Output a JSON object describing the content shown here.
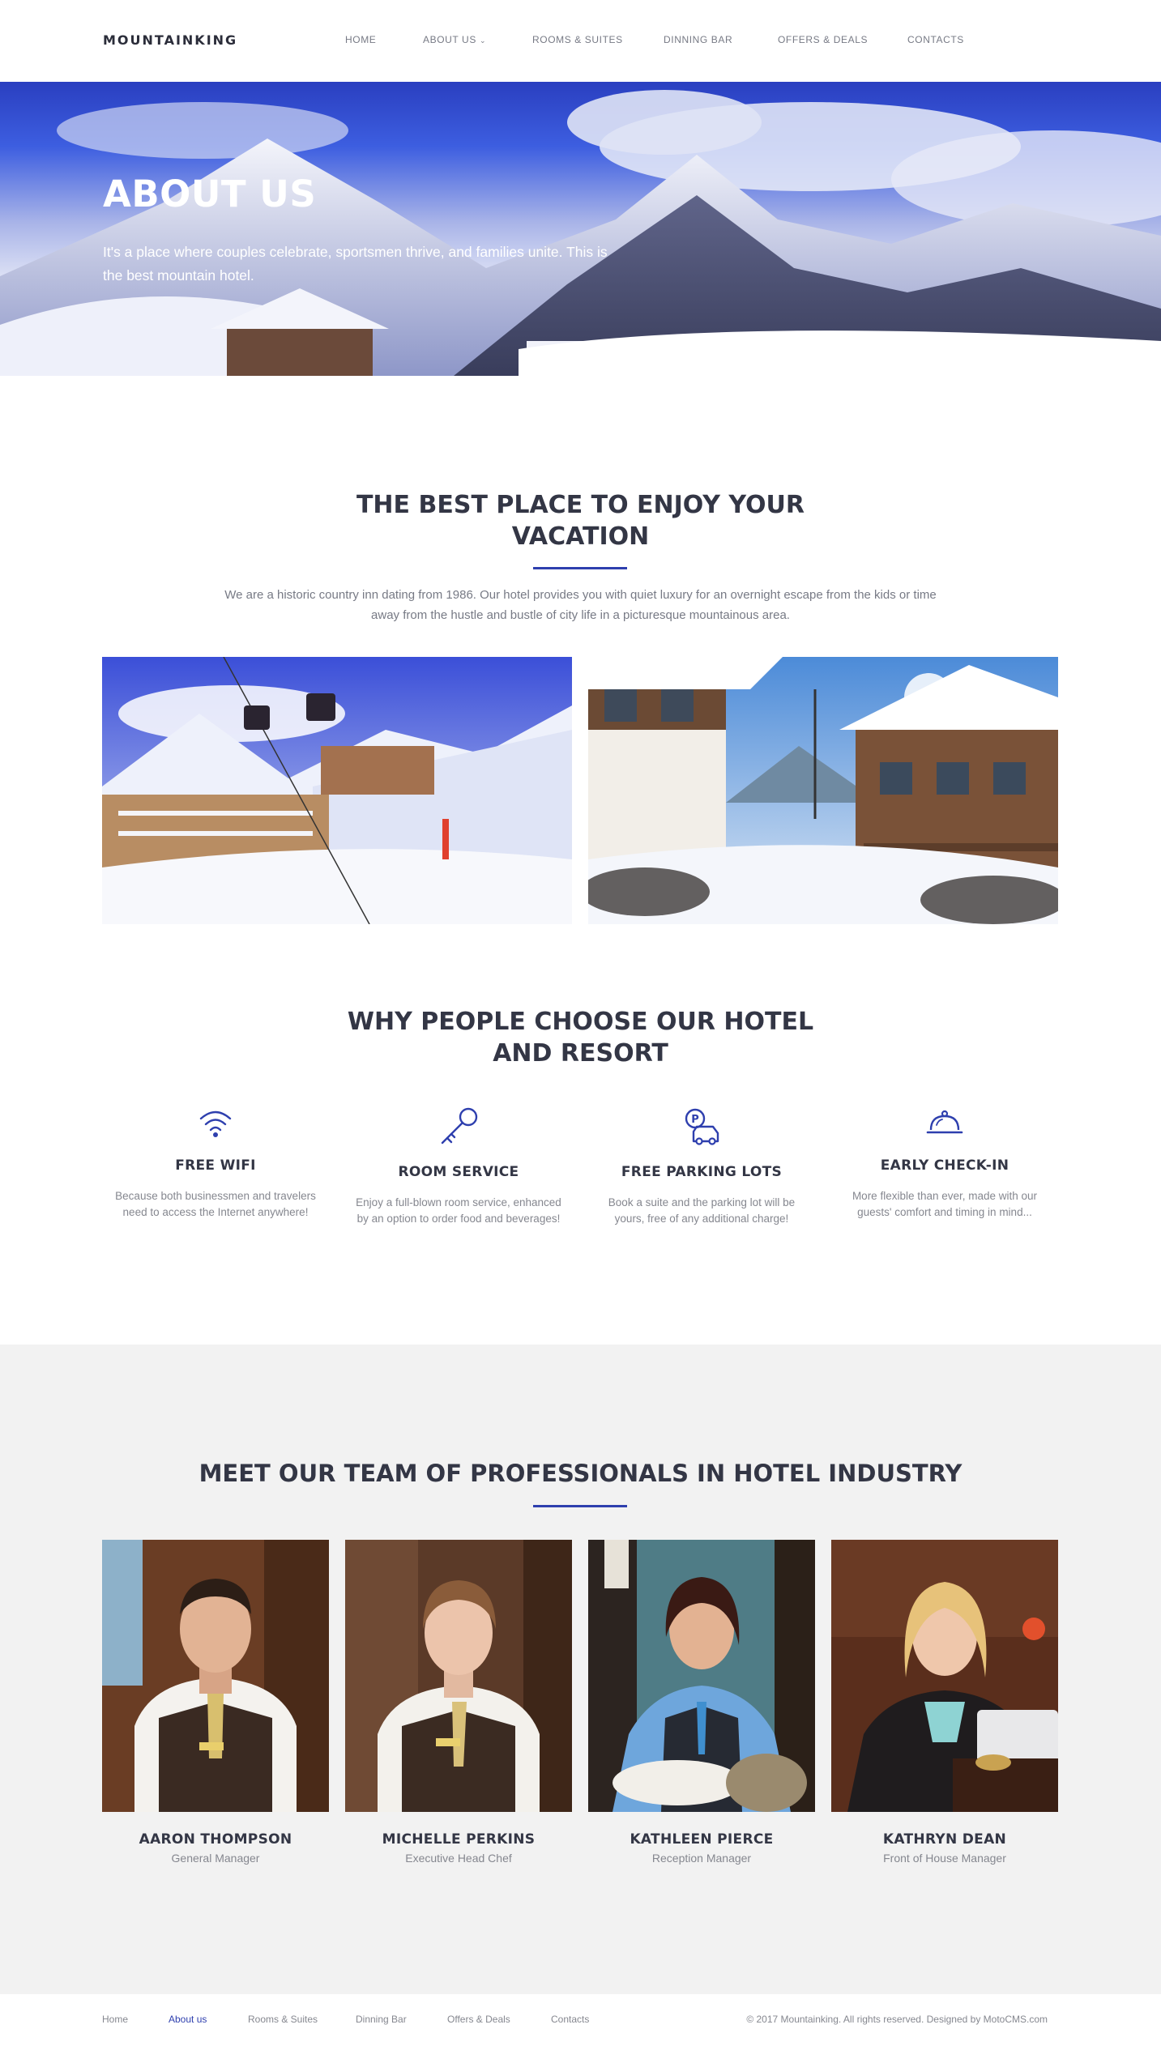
{
  "header": {
    "logo": "MOUNTAINKING",
    "nav": [
      {
        "label": "HOME"
      },
      {
        "label": "ABOUT US"
      },
      {
        "label": "ROOMS & SUITES"
      },
      {
        "label": "DINNING BAR"
      },
      {
        "label": "OFFERS & DEALS"
      },
      {
        "label": "CONTACTS"
      }
    ]
  },
  "hero": {
    "title": "ABOUT US",
    "text": "It's a place where couples celebrate, sportsmen thrive, and families unite. This is the best mountain hotel."
  },
  "intro": {
    "title_line1": "THE BEST PLACE TO ENJOY YOUR",
    "title_line2": "VACATION",
    "text": "We are a historic country inn dating from 1986. Our hotel provides you with quiet luxury for an overnight escape from the kids or time away from the hustle and bustle of city life in a picturesque mountainous area."
  },
  "why": {
    "title_line1": "WHY PEOPLE CHOOSE OUR HOTEL",
    "title_line2": "AND RESORT",
    "features": [
      {
        "icon": "wifi-icon",
        "title": "FREE WIFI",
        "text": "Because both businessmen and travelers need to access the Internet anywhere!"
      },
      {
        "icon": "key-icon",
        "title": "ROOM SERVICE",
        "text": "Enjoy a full-blown room service, enhanced by an option to order food and beverages!"
      },
      {
        "icon": "parking-car-icon",
        "title": "FREE PARKING LOTS",
        "text": "Book a suite and the parking lot will be yours, free of any additional charge!"
      },
      {
        "icon": "service-bell-icon",
        "title": "EARLY CHECK-IN",
        "text": "More flexible than ever, made with our guests' comfort and timing in mind..."
      }
    ]
  },
  "team": {
    "title": "MEET OUR TEAM OF PROFESSIONALS IN HOTEL INDUSTRY",
    "members": [
      {
        "name": "AARON THOMPSON",
        "role": "General Manager"
      },
      {
        "name": "MICHELLE PERKINS",
        "role": "Executive Head Chef"
      },
      {
        "name": "KATHLEEN PIERCE",
        "role": "Reception Manager"
      },
      {
        "name": "KATHRYN DEAN",
        "role": "Front of House Manager"
      }
    ]
  },
  "footer": {
    "nav": [
      {
        "label": "Home"
      },
      {
        "label": "About us"
      },
      {
        "label": "Rooms & Suites"
      },
      {
        "label": "Dinning Bar"
      },
      {
        "label": "Offers & Deals"
      },
      {
        "label": "Contacts"
      }
    ],
    "copyright": "© 2017 Mountainking. All rights reserved. Designed by MotoCMS.com"
  },
  "colors": {
    "accent": "#2e3fae",
    "heading": "#333645",
    "muted_text": "#85878f",
    "team_background": "#f2f2f2"
  }
}
